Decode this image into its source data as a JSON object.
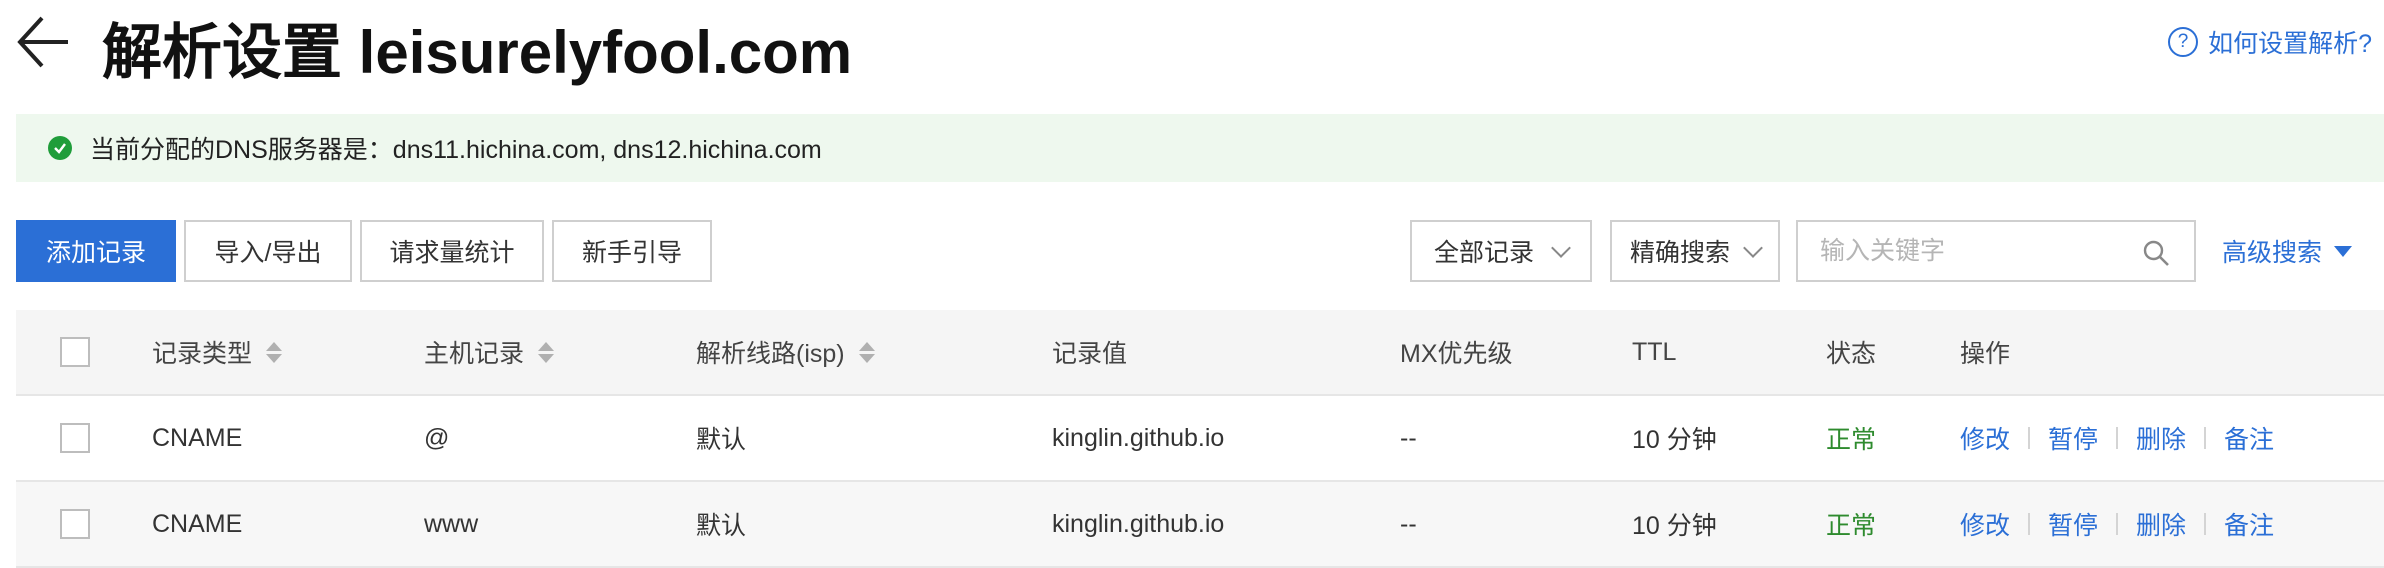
{
  "header": {
    "title": "解析设置 leisurelyfool.com",
    "help_label": "如何设置解析?",
    "help_icon_glyph": "?"
  },
  "notice": {
    "text": "当前分配的DNS服务器是：dns11.hichina.com, dns12.hichina.com",
    "status_color": "#1f9d3a"
  },
  "toolbar": {
    "add_record": "添加记录",
    "import_export": "导入/导出",
    "request_stats": "请求量统计",
    "beginner_guide": "新手引导",
    "record_filter": "全部记录",
    "search_mode": "精确搜索",
    "search_placeholder": "输入关键字",
    "advanced_search": "高级搜索",
    "accent_color": "#2b6fd6"
  },
  "table": {
    "columns": {
      "type": "记录类型",
      "host": "主机记录",
      "line": "解析线路(isp)",
      "value": "记录值",
      "mx": "MX优先级",
      "ttl": "TTL",
      "status": "状态",
      "ops": "操作"
    },
    "rows": [
      {
        "type": "CNAME",
        "host": "@",
        "line": "默认",
        "value": "kinglin.github.io",
        "mx": "--",
        "ttl": "10 分钟",
        "status": "正常",
        "ops": [
          "修改",
          "暂停",
          "删除",
          "备注"
        ]
      },
      {
        "type": "CNAME",
        "host": "www",
        "line": "默认",
        "value": "kinglin.github.io",
        "mx": "--",
        "ttl": "10 分钟",
        "status": "正常",
        "ops": [
          "修改",
          "暂停",
          "删除",
          "备注"
        ]
      }
    ],
    "status_color": "#2e8b2e"
  }
}
